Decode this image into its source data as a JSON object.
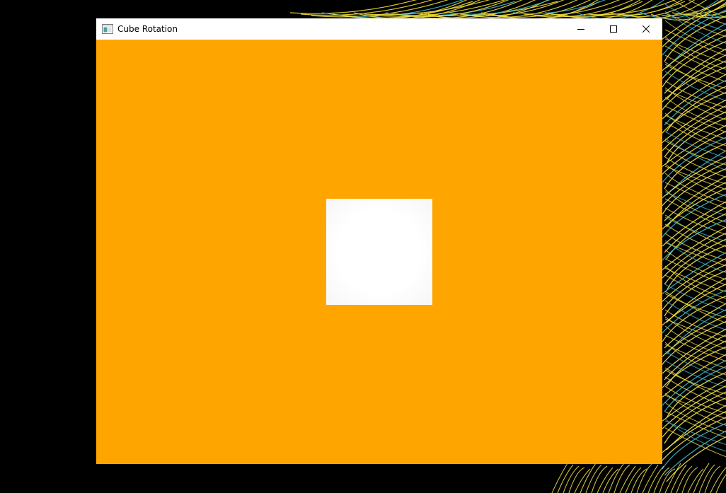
{
  "window": {
    "title": "Cube Rotation",
    "controls": {
      "minimize": "minimize",
      "maximize": "maximize",
      "close": "close"
    }
  },
  "scene": {
    "background_color": "#ffa500",
    "cube_color": "#ffffff"
  },
  "desktop": {
    "background_color": "#000000",
    "wallpaper": "palm-leaves-yellow-teal"
  }
}
